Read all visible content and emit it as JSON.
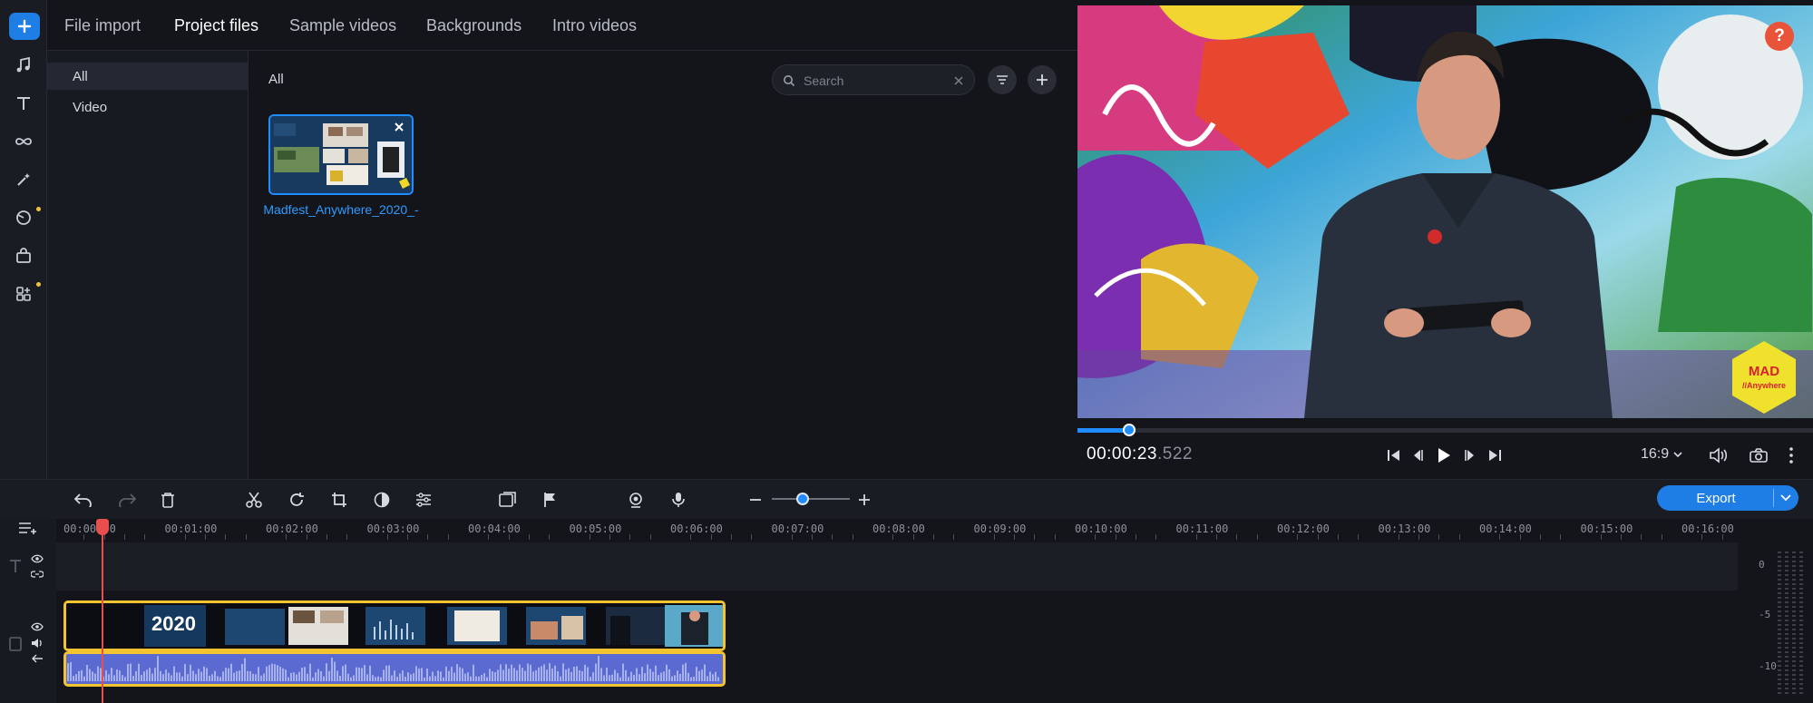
{
  "tabs": [
    "File import",
    "Project files",
    "Sample videos",
    "Backgrounds",
    "Intro videos"
  ],
  "active_tab": "Project files",
  "categories": [
    "All",
    "Video"
  ],
  "content": {
    "heading": "All",
    "search_placeholder": "Search",
    "file_name": "Madfest_Anywhere_2020_-"
  },
  "preview": {
    "help_label": "?",
    "logo_line1": "MAD",
    "logo_line2": "//Anywhere",
    "progress": 0.07,
    "timecode_main": "00:00:23",
    "timecode_ms": ".522",
    "aspect_ratio": "16:9"
  },
  "toolbar": {
    "export_label": "Export",
    "zoom_level": 0.4
  },
  "timeline": {
    "ruler": [
      "00:00:00",
      "00:01:00",
      "00:02:00",
      "00:03:00",
      "00:04:00",
      "00:05:00",
      "00:06:00",
      "00:07:00",
      "00:08:00",
      "00:09:00",
      "00:10:00",
      "00:11:00",
      "00:12:00",
      "00:13:00",
      "00:14:00",
      "00:15:00",
      "00:16:00"
    ],
    "clip_year": "2020",
    "meter_labels": [
      "0",
      "-5",
      "-10"
    ]
  },
  "colors": {
    "accent": "#1f7de6",
    "clip_border": "#f4c430",
    "playhead": "#e84e4e",
    "link": "#2e9bff"
  }
}
